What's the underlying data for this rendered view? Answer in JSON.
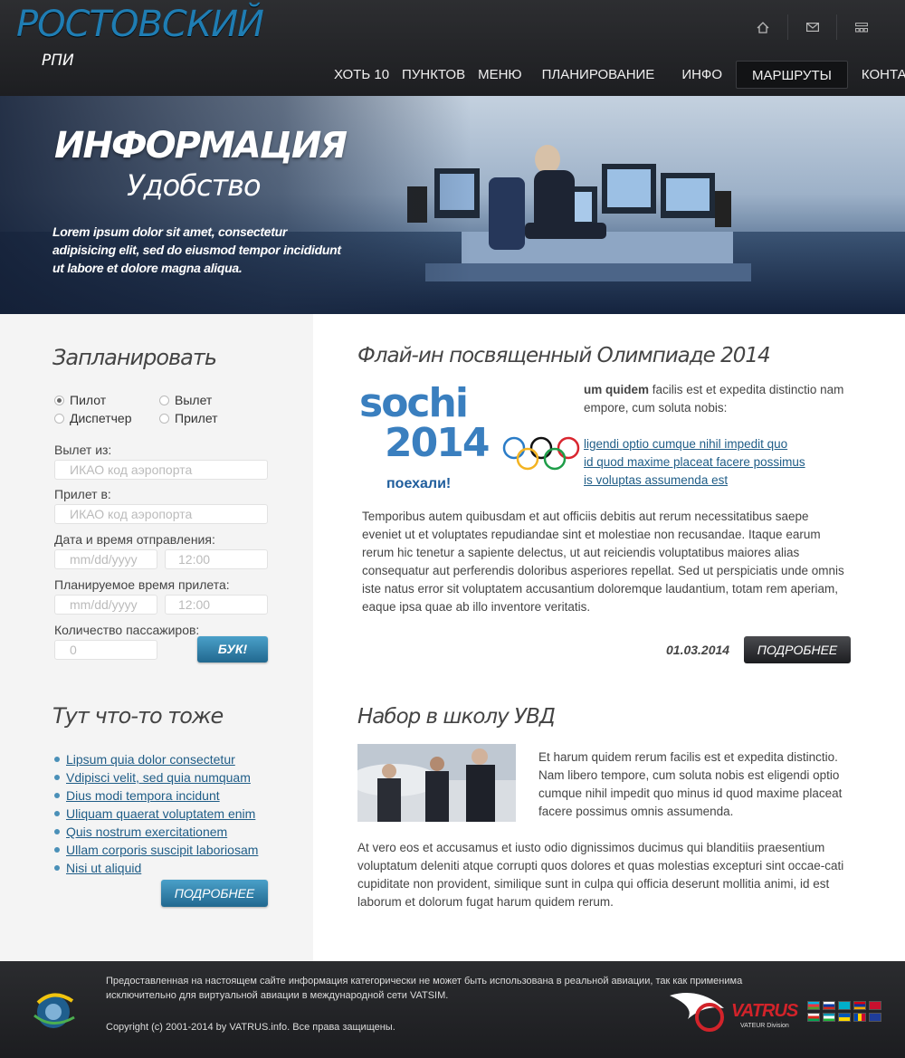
{
  "header": {
    "logo_title": "РОСТОВСКИЙ",
    "logo_sub": "РПИ",
    "icons": [
      "home-icon",
      "mail-icon",
      "sitemap-icon"
    ],
    "nav": [
      {
        "label": "ХОТЬ 10",
        "active": false
      },
      {
        "label": "ПУНКТОВ",
        "active": false
      },
      {
        "label": "МЕНЮ",
        "active": false
      },
      {
        "label": "ПЛАНИРОВАНИЕ",
        "active": false
      },
      {
        "label": "ИНФО",
        "active": false
      },
      {
        "label": "МАРШРУТЫ",
        "active": true
      },
      {
        "label": "КОНТАКТЫ",
        "active": false
      }
    ]
  },
  "banner": {
    "title": "ИНФОРМАЦИЯ",
    "subtitle": "Удобство",
    "text": "Lorem ipsum dolor sit amet, consectetur adipisicing elit, sed do eiusmod tempor incididunt ut labore et dolore magna aliqua."
  },
  "sidebar": {
    "plan_title": "Запланировать",
    "radios": [
      {
        "label": "Пилот",
        "checked": true
      },
      {
        "label": "Вылет",
        "checked": false
      },
      {
        "label": "Диспетчер",
        "checked": false
      },
      {
        "label": "Прилет",
        "checked": false
      }
    ],
    "departure_label": "Вылет из:",
    "departure_placeholder": "ИКАО код аэропорта",
    "arrival_label": "Прилет в:",
    "arrival_placeholder": "ИКАО код аэропорта",
    "dep_time_label": "Дата и время отправления:",
    "dep_date_placeholder": "mm/dd/yyyy",
    "dep_time_placeholder": "12:00",
    "arr_time_label": "Планируемое время прилета:",
    "arr_date_placeholder": "mm/dd/yyyy",
    "arr_time_placeholder": "12:00",
    "pax_label": "Количество пассажиров:",
    "pax_placeholder": "0",
    "book_button": "БУК!",
    "other_title": "Тут что-то тоже",
    "links": [
      "Lipsum quia dolor consectetur",
      "Vdipisci velit, sed quia numquam",
      "Dius modi tempora incidunt",
      "Uliquam quaerat voluptatem enim",
      "Quis nostrum exercitationem",
      "Ullam corporis suscipit laboriosam",
      "Nisi ut aliquid"
    ],
    "more_button": "ПОДРОБНЕЕ"
  },
  "article1": {
    "title": "Флай-ин посвященный Олимпиаде 2014",
    "image_text_top": "sochi",
    "image_text_year": "2014",
    "image_text_go": "поехали!",
    "intro_bold": "um quidem",
    "intro_rest": " facilis est et expedita distinctio nam",
    "intro_line2": "empore, cum soluta nobis:",
    "links": [
      "ligendi optio cumque nihil impedit quo",
      "id quod maxime placeat facere possimus",
      "is voluptas assumenda est"
    ],
    "body": "Temporibus autem quibusdam et aut officiis debitis aut rerum necessitatibus saepe eveniet ut et voluptates repudiandae sint et molestiae non recusandae. Itaque earum rerum hic tenetur a sapiente delectus, ut aut reiciendis voluptatibus maiores alias consequatur aut perferendis doloribus asperiores repellat. Sed ut perspiciatis unde omnis iste natus error sit voluptatem accusantium doloremque laudantium, totam rem aperiam, eaque ipsa quae ab illo inventore veritatis.",
    "date": "01.03.2014",
    "more_button": "ПОДРОБНЕЕ"
  },
  "article2": {
    "title": "Набор в школу УВД",
    "intro": "Et harum quidem rerum facilis est et expedita distinctio. Nam libero tempore, cum soluta nobis est eligendi optio cumque nihil impedit quo minus id quod maxime placeat facere possimus omnis assumenda.",
    "body": "At vero eos et accusamus et iusto odio dignissimos ducimus qui blanditiis praesentium voluptatum deleniti atque corrupti quos dolores et quas molestias excepturi sint occae-cati cupiditate non provident, similique sunt in culpa qui officia deserunt mollitia animi, id est laborum et dolorum fugat harum quidem rerum."
  },
  "footer": {
    "disclaimer": "Предоставленная на настоящем сайте информация категорически не может быть использована в реальной авиации, так как применима исключительно для виртуальной авиации в международной сети VATSIM.",
    "copyright": "Copyright (c) 2001-2014 by VATRUS.info. Все права защищены.",
    "brand": "VATRUS",
    "brand_sub": "VATEUR Division"
  },
  "colors": {
    "accent": "#1f7db3",
    "link": "#1f5d87",
    "button_blue": "#2f7fab",
    "header_bg": "#2a2b2e",
    "sidebar_bg": "#f4f4f4"
  }
}
